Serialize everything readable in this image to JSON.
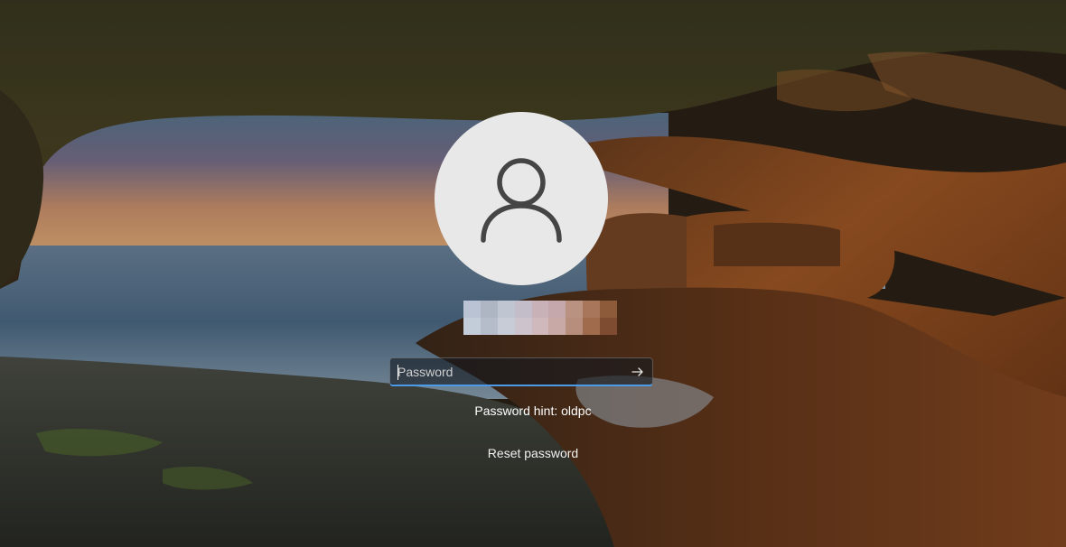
{
  "lock_screen": {
    "user": {
      "avatar_icon": "person-icon",
      "name_pixelated": true
    },
    "password_field": {
      "placeholder": "Password",
      "value": "",
      "submit_icon": "arrow-right-icon"
    },
    "hint_text": "Password hint: oldpc",
    "reset_link": "Reset password"
  },
  "colors": {
    "focus_underline": "#4c9be8",
    "avatar_bg": "#e8e8e8",
    "avatar_icon": "#454545"
  }
}
